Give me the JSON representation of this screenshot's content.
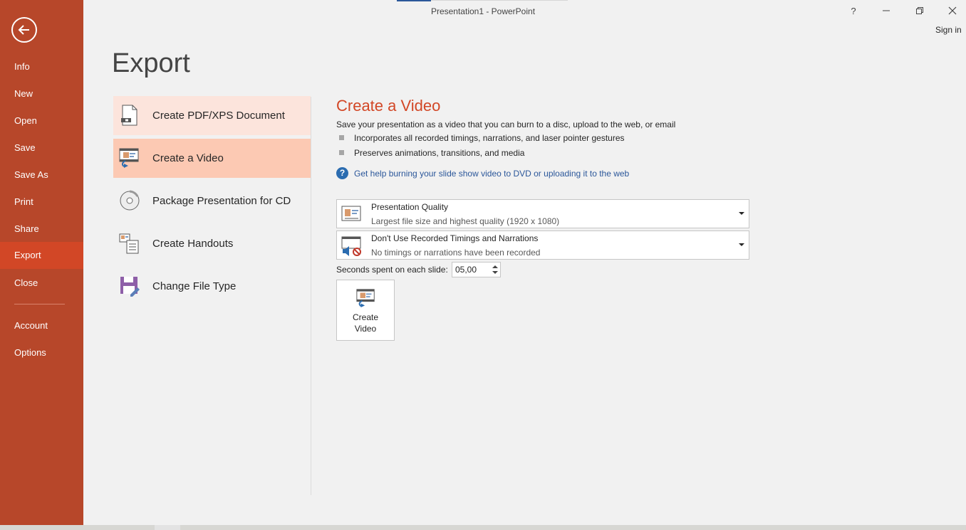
{
  "window": {
    "title": "Presentation1 - PowerPoint",
    "help": "?",
    "sign_in": "Sign in"
  },
  "sidebar": {
    "back_icon": "back-arrow-icon",
    "items": [
      {
        "label": "Info"
      },
      {
        "label": "New"
      },
      {
        "label": "Open"
      },
      {
        "label": "Save"
      },
      {
        "label": "Save As"
      },
      {
        "label": "Print"
      },
      {
        "label": "Share"
      },
      {
        "label": "Export",
        "active": true
      },
      {
        "label": "Close"
      },
      {
        "label": "Account"
      },
      {
        "label": "Options"
      }
    ]
  },
  "page": {
    "title": "Export"
  },
  "export_options": [
    {
      "label": "Create PDF/XPS Document",
      "icon": "pdf-document-icon"
    },
    {
      "label": "Create a Video",
      "icon": "video-icon",
      "selected": true
    },
    {
      "label": "Package Presentation for CD",
      "icon": "cd-icon"
    },
    {
      "label": "Create Handouts",
      "icon": "handouts-icon"
    },
    {
      "label": "Change File Type",
      "icon": "file-type-icon"
    }
  ],
  "video": {
    "title": "Create a Video",
    "description": "Save your presentation as a video that you can burn to a disc, upload to the web, or email",
    "bullets": [
      "Incorporates all recorded timings, narrations, and laser pointer gestures",
      "Preserves animations, transitions, and media"
    ],
    "help_link": "Get help burning your slide show video to DVD or uploading it to the web",
    "quality": {
      "main": "Presentation Quality",
      "sub": "Largest file size and highest quality (1920 x 1080)"
    },
    "timings": {
      "main": "Don't Use Recorded Timings and Narrations",
      "sub": "No timings or narrations have been recorded"
    },
    "seconds_label": "Seconds spent on each slide:",
    "seconds_value": "05,00",
    "create_button": "Create\nVideo"
  },
  "colors": {
    "sidebar": "#b7472a",
    "sidebar_active": "#d24726",
    "accent": "#d24726",
    "selected": "#fcc9b3",
    "link": "#2b579a"
  }
}
